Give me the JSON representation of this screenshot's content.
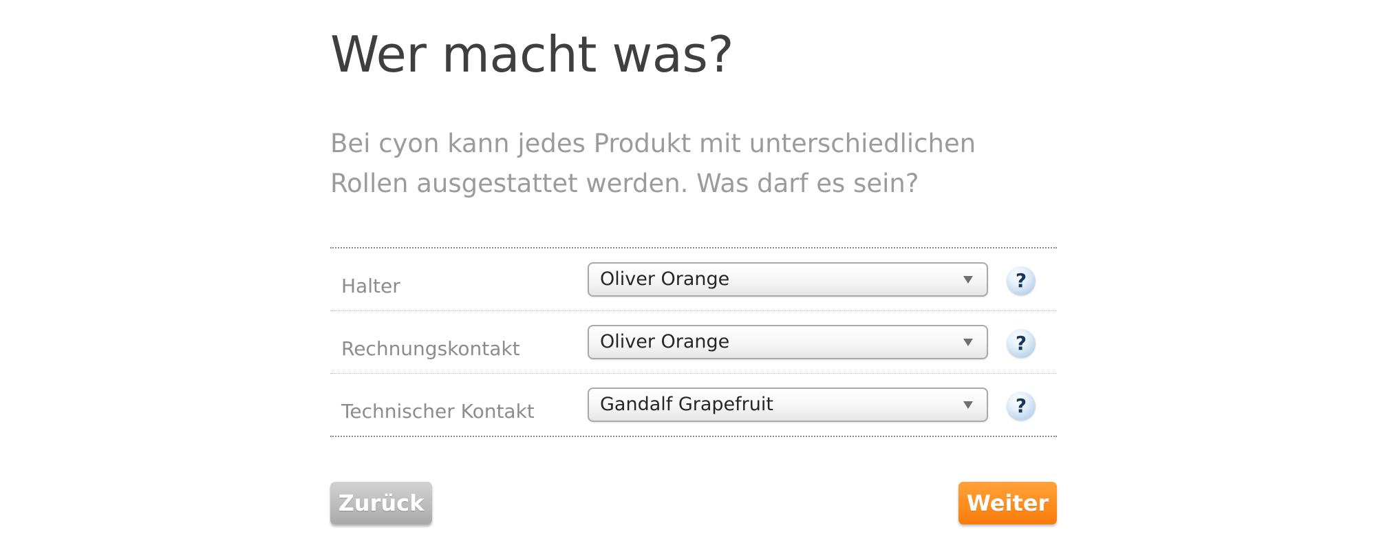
{
  "page": {
    "title": "Wer macht was?",
    "intro": "Bei cyon kann jedes Produkt mit unterschiedlichen Rollen ausgestattet werden. Was darf es sein?"
  },
  "roles": [
    {
      "label": "Halter",
      "selected": "Oliver Orange",
      "help_icon": "?"
    },
    {
      "label": "Rechnungskontakt",
      "selected": "Oliver Orange",
      "help_icon": "?"
    },
    {
      "label": "Technischer Kontakt",
      "selected": "Gandalf Grapefruit",
      "help_icon": "?"
    }
  ],
  "icons": {
    "dropdown": "chevron-down-icon",
    "help": "help-icon"
  },
  "buttons": {
    "back_label": "Zurück",
    "next_label": "Weiter"
  },
  "colors": {
    "title": "#3f3f3f",
    "intro": "#9b9b9b",
    "back_button": "#bdbdbd",
    "next_button": "#ff8d1f",
    "help_icon_text": "#17375f"
  }
}
